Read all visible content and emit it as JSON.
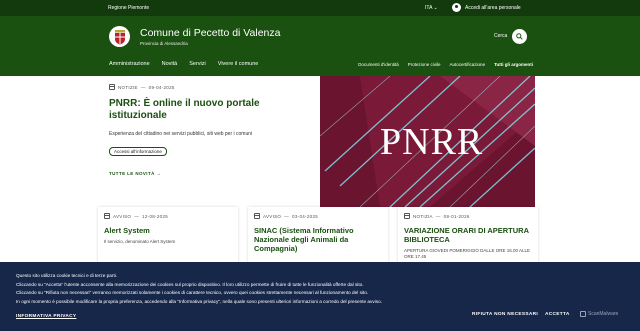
{
  "topbar": {
    "region": "Regione Piemonte",
    "lang": "ITA",
    "login": "Accedi all'area personale"
  },
  "header": {
    "title": "Comune di Pecetto di Valenza",
    "subtitle": "Provincia di Alessandria",
    "search_label": "Cerca"
  },
  "nav": {
    "main": [
      "Amministrazione",
      "Novità",
      "Servizi",
      "Vivere il comune"
    ],
    "secondary": [
      "Documenti d'identità",
      "Protezione civile",
      "Autocertificazione",
      "Tutti gli argomenti"
    ]
  },
  "hero": {
    "category": "NOTIZIE",
    "date": "09-04-2025",
    "title": "PNRR: È online il nuovo portale istituzionale",
    "description": "Esperienza del cittadino nei servizi pubblici, siti web per i comuni",
    "chip": "Accessi all'informazione",
    "all_news": "TUTTE LE NOVITÀ",
    "image_text": "PNRR"
  },
  "cards": [
    {
      "category": "AVVISO",
      "date": "12-08-2025",
      "title": "Alert System",
      "description": "Il servizio, denominato Alert System"
    },
    {
      "category": "AVVISO",
      "date": "03-04-2025",
      "title": "SINAC (Sistema Informativo Nazionale degli Animali da Compagnia)",
      "description": ""
    },
    {
      "category": "NOTIZIA",
      "date": "08-01-2026",
      "title": "VARIAZIONE ORARI DI APERTURA BIBLIOTECA",
      "description": "APERTURA GIOVEDI POMERIGGIO DALLE ORE 15.00 ALLE ORE 17.45"
    }
  ],
  "cookie": {
    "lines": [
      "Questo sito utilizza cookie tecnici e di terze parti.",
      "Cliccando su \"Accetta\" l'utente acconsente alla memorizzazione dei cookies sul proprio dispositivo. Il loro utilizzo permette di fruire di tutte le funzionalità offerte dal sito.",
      "Cliccando su \"Rifiuta non necessari\" verranno memorizzati solamente i cookies di carattere tecnico, ovvero quei cookies strettamente necessari al funzionamento del sito.",
      "In ogni momento è possibile modificare la propria preferenza, accedendo alla \"Informativa privacy\", nella quale sono presenti ulteriori informazioni a corredo del presente avviso."
    ],
    "privacy_link": "INFORMATIVA PRIVACY",
    "reject": "RIFIUTA NON NECESSARI",
    "accept": "ACCETTA",
    "badge": "ScanMalware"
  },
  "colors": {
    "topbar": "#123a0c",
    "header": "#1a5010",
    "accent": "#1a5010",
    "cookie_bg": "#17274a",
    "hero_image": "#6a1430"
  }
}
